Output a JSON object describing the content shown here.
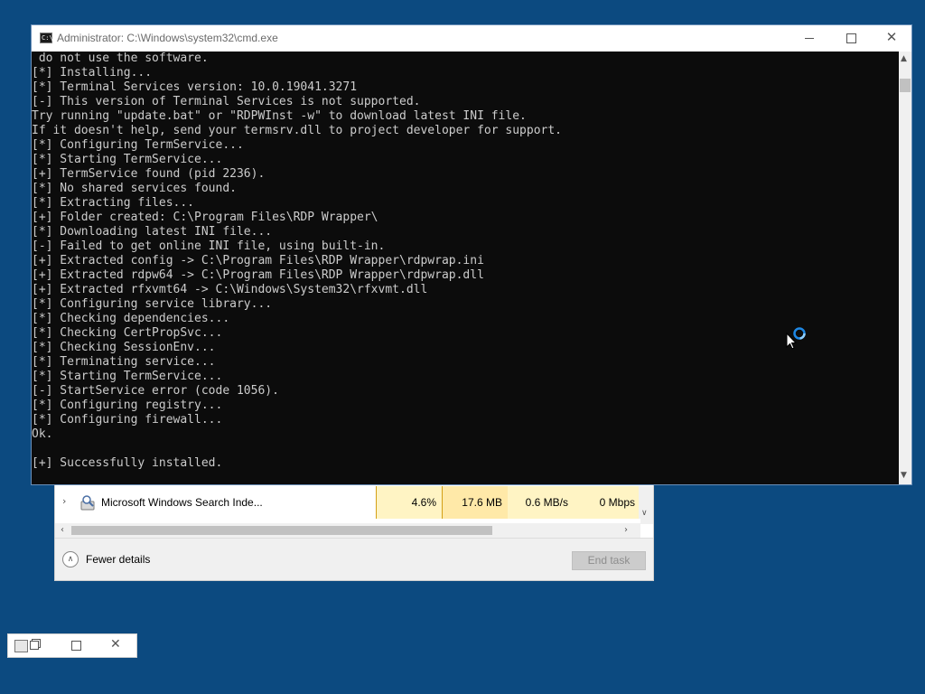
{
  "cmd_window": {
    "title": "Administrator: C:\\Windows\\system32\\cmd.exe",
    "app_icon_text": "C:\\",
    "close_glyph": "✕",
    "console_lines": [
      " do not use the software.",
      "[*] Installing...",
      "[*] Terminal Services version: 10.0.19041.3271",
      "[-] This version of Terminal Services is not supported.",
      "Try running \"update.bat\" or \"RDPWInst -w\" to download latest INI file.",
      "If it doesn't help, send your termsrv.dll to project developer for support.",
      "[*] Configuring TermService...",
      "[*] Starting TermService...",
      "[+] TermService found (pid 2236).",
      "[*] No shared services found.",
      "[*] Extracting files...",
      "[+] Folder created: C:\\Program Files\\RDP Wrapper\\",
      "[*] Downloading latest INI file...",
      "[-] Failed to get online INI file, using built-in.",
      "[+] Extracted config -> C:\\Program Files\\RDP Wrapper\\rdpwrap.ini",
      "[+] Extracted rdpw64 -> C:\\Program Files\\RDP Wrapper\\rdpwrap.dll",
      "[+] Extracted rfxvmt64 -> C:\\Windows\\System32\\rfxvmt.dll",
      "[*] Configuring service library...",
      "[*] Checking dependencies...",
      "[*] Checking CertPropSvc...",
      "[*] Checking SessionEnv...",
      "[*] Terminating service...",
      "[*] Starting TermService...",
      "[-] StartService error (code 1056).",
      "[*] Configuring registry...",
      "[*] Configuring firewall...",
      "Ok.",
      "",
      "[+] Successfully installed."
    ]
  },
  "task_manager": {
    "process": {
      "expand_glyph": "›",
      "name": "Microsoft Windows Search Inde...",
      "cpu": "4.6%",
      "memory": "17.6 MB",
      "disk": "0.6 MB/s",
      "network": "0 Mbps"
    },
    "scroll_down_glyph": "∨",
    "scroll_left_glyph": "‹",
    "scroll_right_glyph": "›",
    "fewer_details_icon": "chevron-up-circle-icon",
    "fewer_details_glyph": "∧",
    "fewer_details_label": "Fewer details",
    "end_task_label": "End task"
  },
  "minimized_window": {
    "close_glyph": "✕"
  },
  "cursor": {
    "icon": "busy-cursor-icon"
  },
  "colors": {
    "desktop": "#0c4a80",
    "console_bg": "#0c0c0c",
    "console_text": "#cccccc",
    "cpu_highlight": "#fff4c4"
  }
}
